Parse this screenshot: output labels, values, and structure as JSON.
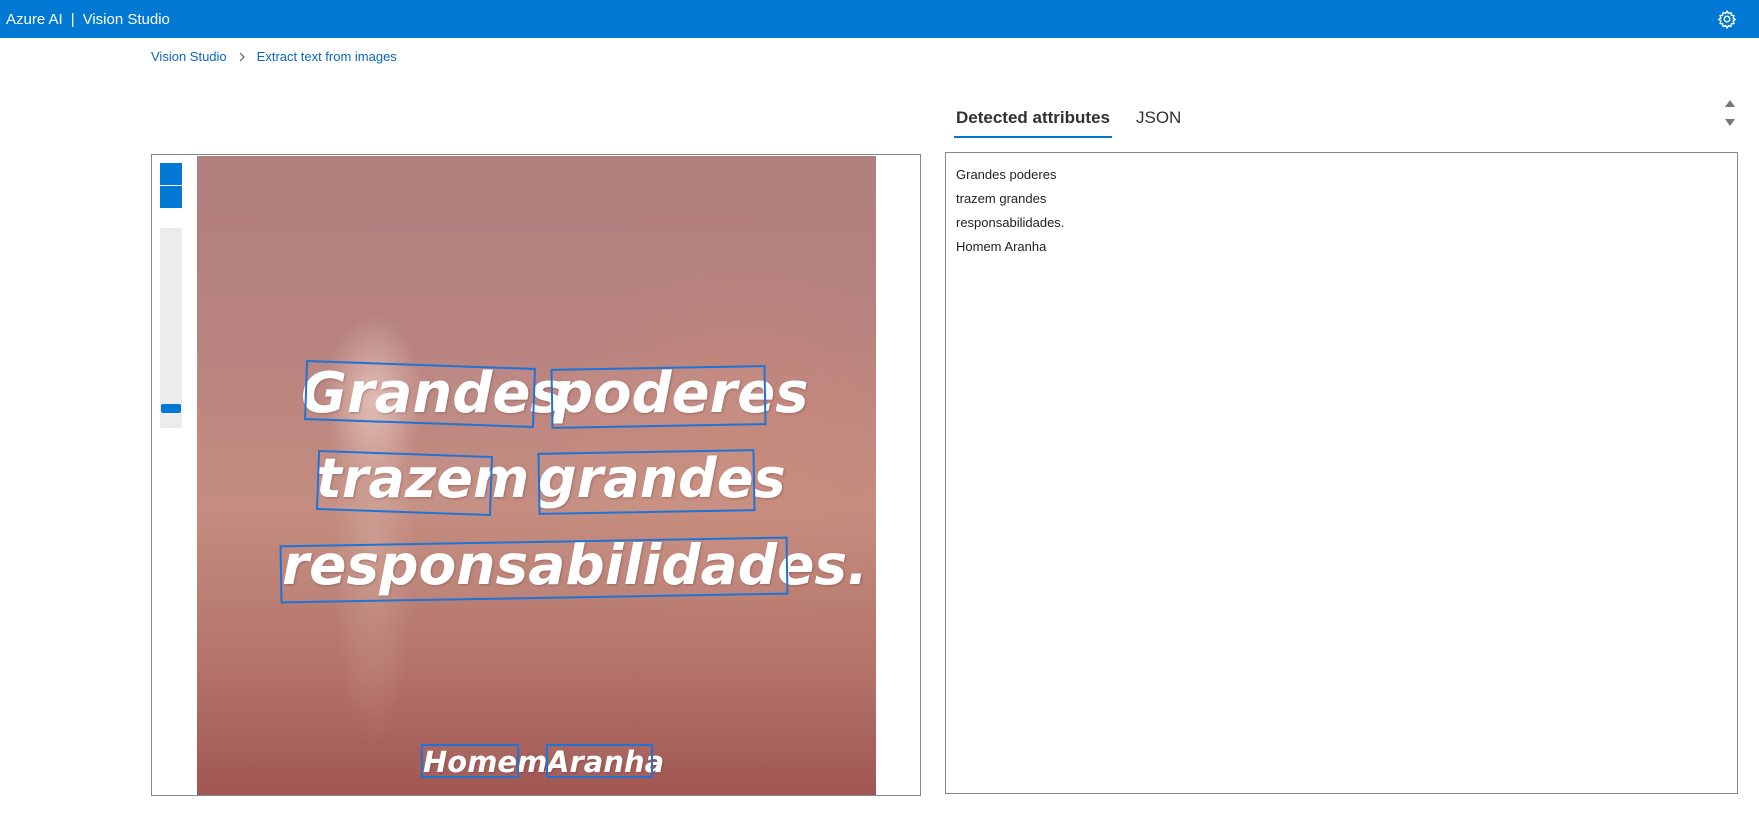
{
  "header": {
    "brand": "Azure AI",
    "separator": "|",
    "product": "Vision Studio",
    "settings_icon": "gear-icon"
  },
  "breadcrumb": {
    "items": [
      "Vision Studio",
      "Extract text from images"
    ],
    "separator_icon": "chevron-right-icon"
  },
  "image_panel": {
    "zoom_level": 0.09,
    "words": [
      "Grandes",
      "poderes",
      "trazem",
      "grandes",
      "responsabilidades.",
      "Homem",
      "Aranha"
    ]
  },
  "results": {
    "tabs": [
      "Detected attributes",
      "JSON"
    ],
    "active_tab": "Detected attributes",
    "lines": [
      "Grandes poderes",
      "trazem grandes",
      "responsabilidades.",
      "Homem Aranha"
    ]
  },
  "colors": {
    "accent": "#0078d4",
    "box": "#1f73d6"
  }
}
